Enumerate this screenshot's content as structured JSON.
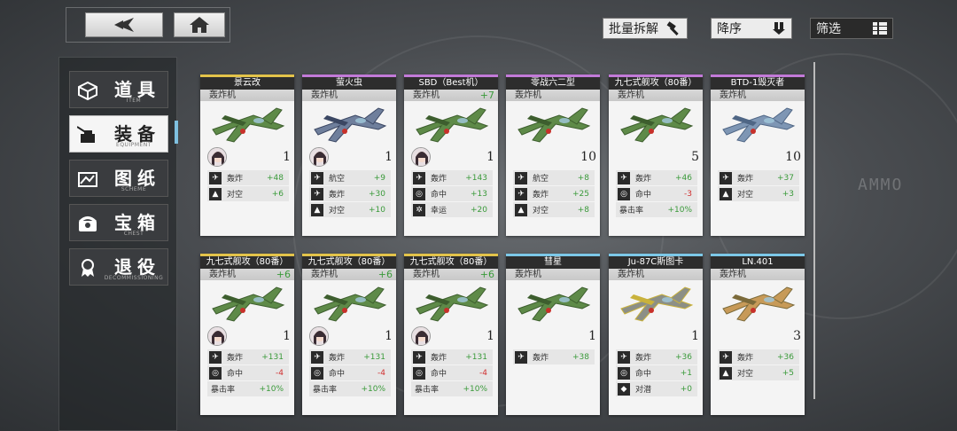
{
  "nav": {
    "back_icon": "back-triangle-icon",
    "home_icon": "home-icon"
  },
  "controls": {
    "batch_scrap_label": "批量拆解",
    "sort_label": "降序",
    "filter_label": "筛选"
  },
  "watermark": "AMMO",
  "sidebar": {
    "items": [
      {
        "name": "道具",
        "en": "ITEM",
        "icon": "cube-icon",
        "active": false
      },
      {
        "name": "装备",
        "en": "EQUIPMENT",
        "icon": "turret-icon",
        "active": true
      },
      {
        "name": "图纸",
        "en": "SCHEME",
        "icon": "blueprint-icon",
        "active": false
      },
      {
        "name": "宝箱",
        "en": "CHEST",
        "icon": "chest-icon",
        "active": false
      },
      {
        "name": "退役",
        "en": "DECOMMISSIONING",
        "icon": "medal-icon",
        "active": false
      }
    ]
  },
  "colors": {
    "gold": "#e3c34a",
    "purple": "#c27ad8",
    "blue": "#7cc8e8",
    "positive": "#3a9a3a",
    "negative": "#d03030"
  },
  "cards": [
    {
      "name": "景云改",
      "type": "轰炸机",
      "rarity": "gold",
      "enhance": "",
      "count": "1",
      "avatar": true,
      "plane": "green-fighter",
      "stats": [
        {
          "icon": "bomb-icon",
          "label": "轰炸",
          "value": "+48"
        },
        {
          "icon": "aa-icon",
          "label": "对空",
          "value": "+6"
        }
      ]
    },
    {
      "name": "萤火虫",
      "type": "轰炸机",
      "rarity": "purple",
      "enhance": "",
      "count": "1",
      "avatar": true,
      "plane": "navy-fighter",
      "stats": [
        {
          "icon": "air-icon",
          "label": "航空",
          "value": "+9"
        },
        {
          "icon": "bomb-icon",
          "label": "轰炸",
          "value": "+30"
        },
        {
          "icon": "aa-icon",
          "label": "对空",
          "value": "+10"
        }
      ]
    },
    {
      "name": "SBD（Best机）",
      "type": "轰炸机",
      "rarity": "purple",
      "enhance": "+7",
      "count": "1",
      "avatar": true,
      "plane": "green-fighter",
      "stats": [
        {
          "icon": "bomb-icon",
          "label": "轰炸",
          "value": "+143"
        },
        {
          "icon": "hit-icon",
          "label": "命中",
          "value": "+13"
        },
        {
          "icon": "luck-icon",
          "label": "幸运",
          "value": "+20"
        }
      ]
    },
    {
      "name": "零战六二型",
      "type": "轰炸机",
      "rarity": "purple",
      "enhance": "",
      "count": "10",
      "avatar": false,
      "plane": "green-fighter",
      "stats": [
        {
          "icon": "air-icon",
          "label": "航空",
          "value": "+8"
        },
        {
          "icon": "bomb-icon",
          "label": "轰炸",
          "value": "+25"
        },
        {
          "icon": "aa-icon",
          "label": "对空",
          "value": "+8"
        }
      ]
    },
    {
      "name": "九七式舰攻（80番）",
      "type": "轰炸机",
      "rarity": "purple",
      "enhance": "",
      "count": "5",
      "avatar": false,
      "plane": "green-fighter",
      "stats": [
        {
          "icon": "bomb-icon",
          "label": "轰炸",
          "value": "+46"
        },
        {
          "icon": "hit-icon",
          "label": "命中",
          "value": "-3"
        },
        {
          "icon": "",
          "label": "暴击率",
          "value": "+10%"
        }
      ]
    },
    {
      "name": "BTD-1毁灭者",
      "type": "轰炸机",
      "rarity": "purple",
      "enhance": "",
      "count": "10",
      "avatar": false,
      "plane": "blue-fighter",
      "stats": [
        {
          "icon": "bomb-icon",
          "label": "轰炸",
          "value": "+37"
        },
        {
          "icon": "aa-icon",
          "label": "对空",
          "value": "+3"
        }
      ]
    },
    {
      "name": "九七式舰攻（80番）",
      "type": "轰炸机",
      "rarity": "gold",
      "enhance": "+6",
      "count": "1",
      "avatar": true,
      "plane": "green-fighter",
      "stats": [
        {
          "icon": "bomb-icon",
          "label": "轰炸",
          "value": "+131"
        },
        {
          "icon": "hit-icon",
          "label": "命中",
          "value": "-4"
        },
        {
          "icon": "",
          "label": "暴击率",
          "value": "+10%"
        }
      ]
    },
    {
      "name": "九七式舰攻（80番）",
      "type": "轰炸机",
      "rarity": "gold",
      "enhance": "+6",
      "count": "1",
      "avatar": true,
      "plane": "green-fighter",
      "stats": [
        {
          "icon": "bomb-icon",
          "label": "轰炸",
          "value": "+131"
        },
        {
          "icon": "hit-icon",
          "label": "命中",
          "value": "-4"
        },
        {
          "icon": "",
          "label": "暴击率",
          "value": "+10%"
        }
      ]
    },
    {
      "name": "九七式舰攻（80番）",
      "type": "轰炸机",
      "rarity": "gold",
      "enhance": "+6",
      "count": "1",
      "avatar": true,
      "plane": "green-fighter",
      "stats": [
        {
          "icon": "bomb-icon",
          "label": "轰炸",
          "value": "+131"
        },
        {
          "icon": "hit-icon",
          "label": "命中",
          "value": "-4"
        },
        {
          "icon": "",
          "label": "暴击率",
          "value": "+10%"
        }
      ]
    },
    {
      "name": "彗星",
      "type": "轰炸机",
      "rarity": "blue",
      "enhance": "",
      "count": "1",
      "avatar": false,
      "plane": "green-fighter",
      "stats": [
        {
          "icon": "bomb-icon",
          "label": "轰炸",
          "value": "+38"
        }
      ]
    },
    {
      "name": "Ju-87C斯图卡",
      "type": "轰炸机",
      "rarity": "blue",
      "enhance": "",
      "count": "1",
      "avatar": false,
      "plane": "yellow-fighter",
      "stats": [
        {
          "icon": "bomb-icon",
          "label": "轰炸",
          "value": "+36"
        },
        {
          "icon": "hit-icon",
          "label": "命中",
          "value": "+1"
        },
        {
          "icon": "asw-icon",
          "label": "对潜",
          "value": "+0"
        }
      ]
    },
    {
      "name": "LN.401",
      "type": "轰炸机",
      "rarity": "blue",
      "enhance": "",
      "count": "3",
      "avatar": false,
      "plane": "tan-fighter",
      "stats": [
        {
          "icon": "bomb-icon",
          "label": "轰炸",
          "value": "+36"
        },
        {
          "icon": "aa-icon",
          "label": "对空",
          "value": "+5"
        }
      ]
    }
  ]
}
